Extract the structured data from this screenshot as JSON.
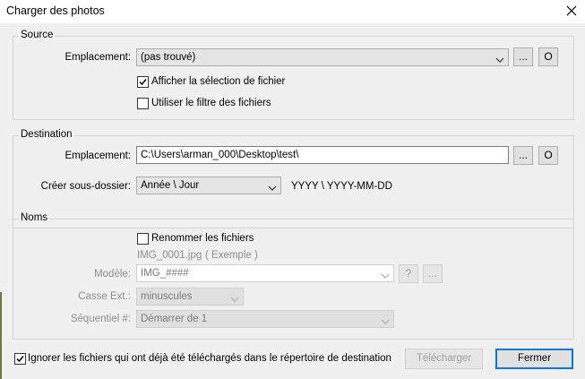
{
  "window": {
    "title": "Charger des photos"
  },
  "source": {
    "legend": "Source",
    "location_label": "Emplacement:",
    "location_value": "(pas trouvé)",
    "browse_label": "...",
    "open_label": "O",
    "show_file_selection": {
      "label": "Afficher la sélection de fichier",
      "checked": true
    },
    "use_file_filter": {
      "label": "Utiliser le filtre des fichiers",
      "checked": false
    }
  },
  "destination": {
    "legend": "Destination",
    "location_label": "Emplacement:",
    "location_value": "C:\\Users\\arman_000\\Desktop\\test\\",
    "browse_label": "...",
    "open_label": "O",
    "subfolder_label": "Créer sous-dossier:",
    "subfolder_value": "Année \\ Jour",
    "subfolder_pattern": "YYYY \\ YYYY-MM-DD"
  },
  "names": {
    "legend": "Noms",
    "rename_files": {
      "label": "Renommer les fichiers",
      "checked": false
    },
    "example_file": "IMG_0001.jpg",
    "example_tag": "( Exemple )",
    "model_label": "Modèle:",
    "model_value": "IMG_####",
    "help_label": "?",
    "more_label": "...",
    "ext_case_label": "Casse Ext.:",
    "ext_case_value": "minuscules",
    "sequence_label": "Séquentiel #:",
    "sequence_value": "Démarrer de 1"
  },
  "footer": {
    "ignore_downloaded": {
      "label": "Ignorer les fichiers qui ont déjà été téléchargés dans le répertoire de destination",
      "checked": true
    },
    "download_label": "Télécharger",
    "close_label": "Fermer"
  },
  "colors": {
    "accent": "#0078d7",
    "dialog_bg": "#f0f0f0",
    "disabled_text": "#8e8e8e"
  },
  "icons": {
    "close": "close-icon",
    "dropdown": "chevron-down-icon",
    "check": "checkmark-icon"
  }
}
